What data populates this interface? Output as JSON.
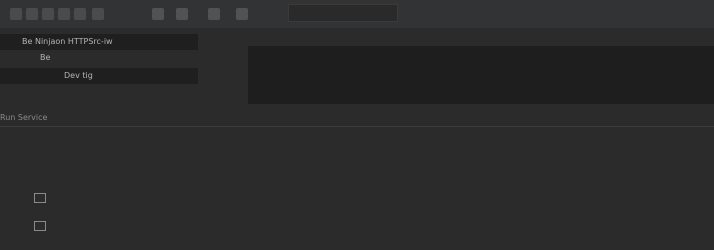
{
  "toolbar": {
    "run_config_field_text": "",
    "icons": [
      "run-icon",
      "debug-icon",
      "refresh-icon",
      "stop-icon",
      "layout-icon",
      "menu-icon",
      "search-icon",
      "minus-icon",
      "settings-icon",
      "arrow-icon"
    ]
  },
  "tree": {
    "items": [
      {
        "label": "Be Ninjaon HTTPSrc-iw",
        "selected": true
      },
      {
        "label": "Be",
        "selected": false
      },
      {
        "label": "Dev tig",
        "selected": true
      },
      {
        "label": "",
        "selected": false
      }
    ]
  },
  "editor": {
    "tabs_text": ""
  },
  "bottom_panel": {
    "tabs_text": "Run  Service"
  },
  "output": {
    "lines": [
      "",
      "",
      ""
    ]
  },
  "colors": {
    "bg": "#2b2b2b",
    "toolbar": "#313335",
    "console": "#1e1e1e",
    "selection": "#1f1f1f"
  }
}
